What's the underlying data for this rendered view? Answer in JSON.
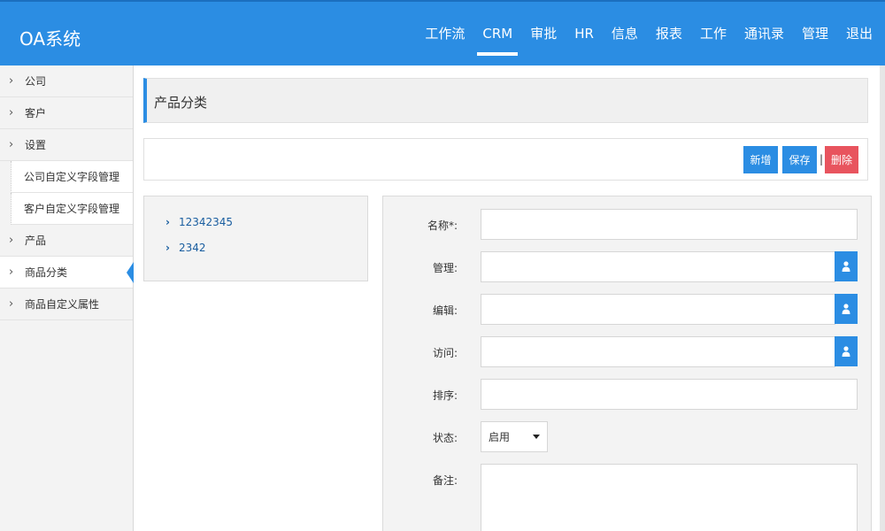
{
  "app": {
    "title": "OA系统"
  },
  "nav": {
    "items": [
      {
        "label": "工作流"
      },
      {
        "label": "CRM"
      },
      {
        "label": "审批"
      },
      {
        "label": "HR"
      },
      {
        "label": "信息"
      },
      {
        "label": "报表"
      },
      {
        "label": "工作"
      },
      {
        "label": "通讯录"
      },
      {
        "label": "管理"
      },
      {
        "label": "退出"
      }
    ],
    "active": "CRM"
  },
  "sidebar": {
    "items": [
      {
        "label": "公司"
      },
      {
        "label": "客户"
      },
      {
        "label": "设置"
      },
      {
        "label": "公司自定义字段管理"
      },
      {
        "label": "客户自定义字段管理"
      },
      {
        "label": "产品"
      },
      {
        "label": "商品分类"
      },
      {
        "label": "商品自定义属性"
      }
    ],
    "active": "商品分类"
  },
  "page": {
    "title": "产品分类"
  },
  "toolbar": {
    "new_label": "新增",
    "save_label": "保存",
    "separator": "|",
    "delete_label": "删除"
  },
  "tree": {
    "nodes": [
      {
        "label": "12342345"
      },
      {
        "label": "2342"
      }
    ]
  },
  "form": {
    "name_label": "名称*:",
    "name_value": "",
    "manage_label": "管理:",
    "manage_value": "",
    "edit_label": "编辑:",
    "edit_value": "",
    "access_label": "访问:",
    "access_value": "",
    "sort_label": "排序:",
    "sort_value": "",
    "status_label": "状态:",
    "status_value": "启用",
    "remark_label": "备注:",
    "remark_value": ""
  },
  "colors": {
    "primary": "#2b8de3",
    "danger": "#e8545e",
    "panel_bg": "#f3f3f3"
  }
}
